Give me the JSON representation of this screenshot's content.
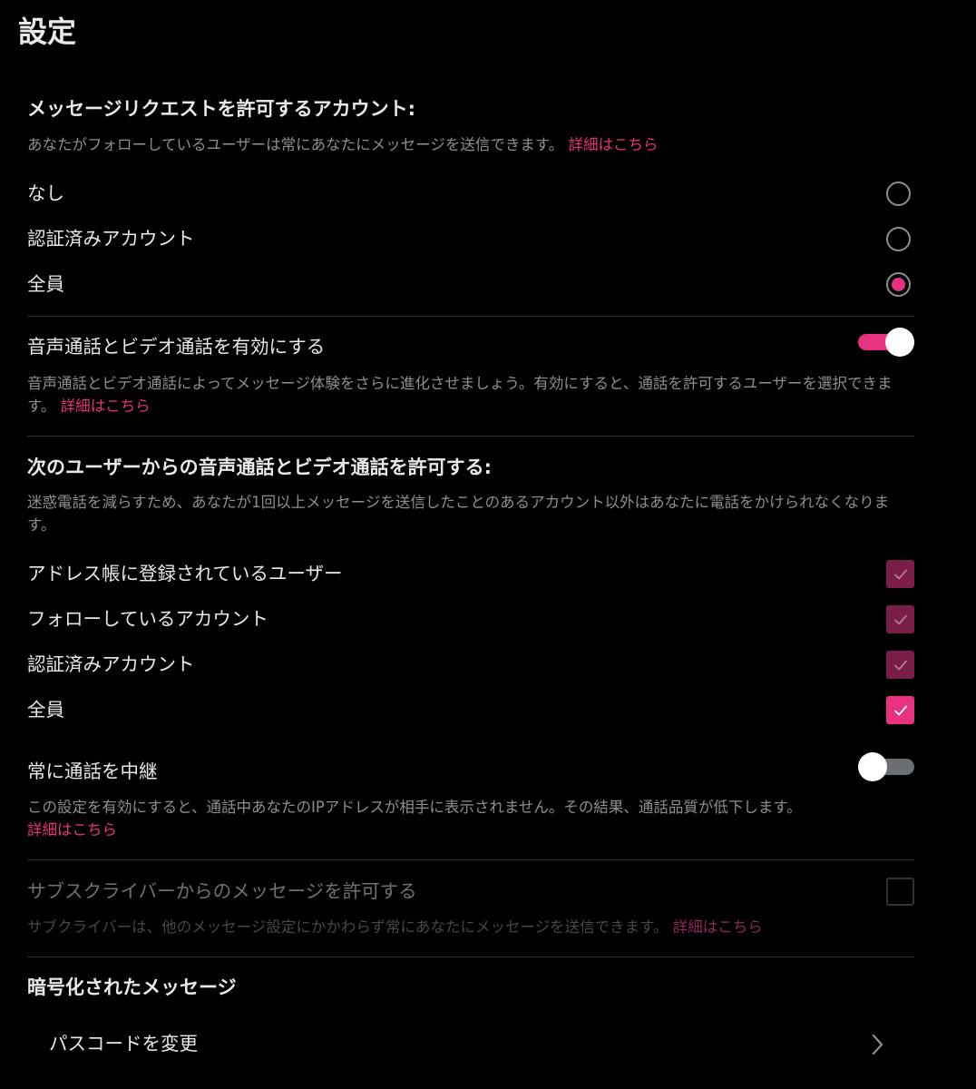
{
  "header": {
    "title": "設定"
  },
  "message_requests": {
    "title": "メッセージリクエストを許可するアカウント:",
    "description": "あなたがフォローしているユーザーは常にあなたにメッセージを送信できます。",
    "link": "詳細はこちら",
    "options": [
      {
        "label": "なし",
        "selected": false
      },
      {
        "label": "認証済みアカウント",
        "selected": false
      },
      {
        "label": "全員",
        "selected": true
      }
    ]
  },
  "calls": {
    "label": "音声通話とビデオ通話を有効にする",
    "enabled": true,
    "description": "音声通話とビデオ通話によってメッセージ体験をさらに進化させましょう。有効にすると、通話を許可するユーザーを選択できます。",
    "link": "詳細はこちら"
  },
  "allow_calls_from": {
    "title": "次のユーザーからの音声通話とビデオ通話を許可する:",
    "description": "迷惑電話を減らすため、あなたが1回以上メッセージを送信したことのあるアカウント以外はあなたに電話をかけられなくなります。",
    "options": [
      {
        "label": "アドレス帳に登録されているユーザー",
        "checked": true
      },
      {
        "label": "フォローしているアカウント",
        "checked": true
      },
      {
        "label": "認証済みアカウント",
        "checked": true
      },
      {
        "label": "全員",
        "checked": true
      }
    ]
  },
  "relay": {
    "label": "常に通話を中継",
    "enabled": false,
    "description": "この設定を有効にすると、通話中あなたのIPアドレスが相手に表示されません。その結果、通話品質が低下します。",
    "link": "詳細はこちら"
  },
  "subscribers": {
    "label": "サブスクライバーからのメッセージを許可する",
    "checked": false,
    "description": "サブクライバーは、他のメッセージ設定にかかわらず常にあなたにメッセージを送信できます。",
    "link": "詳細はこちら"
  },
  "encrypted": {
    "title": "暗号化されたメッセージ",
    "change_passcode": "パスコードを変更"
  },
  "colors": {
    "accent": "#e8317f",
    "accent_dim": "#7a1e48",
    "background": "#000000",
    "text": "#e7e9ea",
    "secondary_text": "#8b8f94",
    "divider": "#2f3336"
  }
}
